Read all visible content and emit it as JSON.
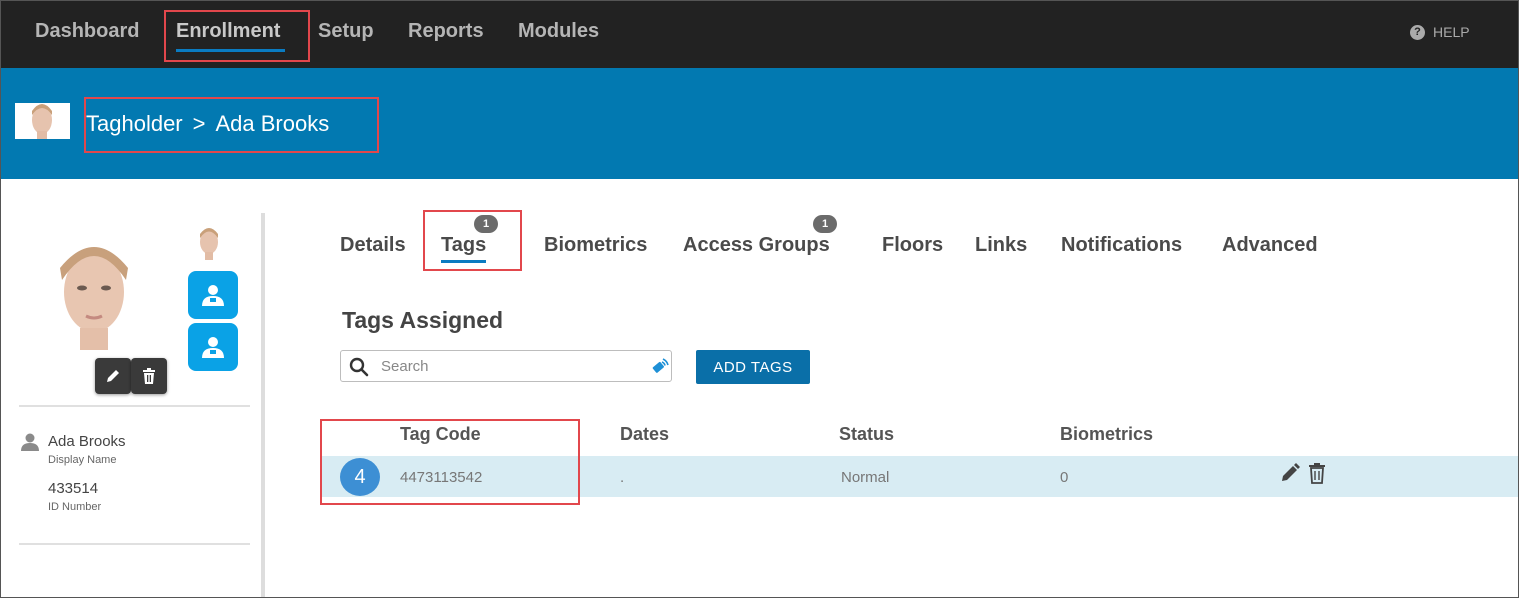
{
  "nav": {
    "items": [
      "Dashboard",
      "Enrollment",
      "Setup",
      "Reports",
      "Modules"
    ],
    "active": "Enrollment",
    "help": "HELP"
  },
  "banner": {
    "section": "Tagholder",
    "separator": ">",
    "name": "Ada Brooks"
  },
  "profile": {
    "display_name": "Ada Brooks",
    "display_name_label": "Display Name",
    "id_number": "433514",
    "id_number_label": "ID Number"
  },
  "tabs": [
    {
      "label": "Details"
    },
    {
      "label": "Tags",
      "badge": "1",
      "active": true
    },
    {
      "label": "Biometrics"
    },
    {
      "label": "Access Groups",
      "badge": "1"
    },
    {
      "label": "Floors"
    },
    {
      "label": "Links"
    },
    {
      "label": "Notifications"
    },
    {
      "label": "Advanced"
    }
  ],
  "tags_section": {
    "title": "Tags Assigned",
    "search_placeholder": "Search",
    "add_button": "ADD TAGS"
  },
  "table": {
    "columns": [
      "Tag Code",
      "Dates",
      "Status",
      "Biometrics"
    ],
    "rows": [
      {
        "index": "4",
        "tag_code": "4473113542",
        "dates": ".",
        "status": "Normal",
        "biometrics": "0"
      }
    ]
  },
  "colors": {
    "nav_bg": "#222222",
    "banner_bg": "#0279b1",
    "accent": "#0a7bc1",
    "highlight": "#e2474c",
    "button": "#0a6fa8",
    "row_bg": "#d8ecf3",
    "side_button": "#0aa2e6"
  },
  "icons": [
    "help-icon",
    "search-icon",
    "tag-scan-icon",
    "edit-icon",
    "trash-icon",
    "user-icon",
    "person-badge-icon"
  ]
}
